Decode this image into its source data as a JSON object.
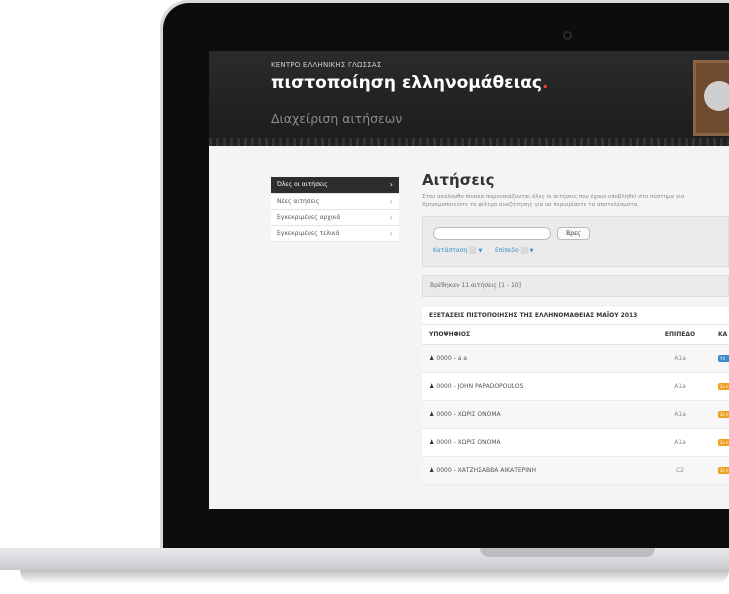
{
  "header": {
    "org": "ΚΕΝΤΡΟ ΕΛΛΗΝΙΚΗΣ ΓΛΩΣΣΑΣ",
    "brand": "πιστοποίηση ελληνομάθειας",
    "brand_dot": ".",
    "section": "Διαχείριση αιτήσεων"
  },
  "sidebar": {
    "items": [
      {
        "label": "Όλες οι αιτήσεις",
        "active": true
      },
      {
        "label": "Νέες αιτήσεις"
      },
      {
        "label": "Εγκεκριμένες αρχικά"
      },
      {
        "label": "Εγκεκριμένες τελικά"
      }
    ]
  },
  "main": {
    "title": "Αιτήσεις",
    "description_line1": "Στον ακόλουθο πίνακα παρουσιάζονται όλες οι αιτήσεις που έχουν υποβληθεί στο σύστημα για",
    "description_line2": "Χρησιμοποιείστε το φίλτρο αναζήτησης για να περιορίσετε τα αποτελέσματα."
  },
  "filters": {
    "search_button": "Βρες",
    "status_label": "Κατάσταση",
    "level_label": "Επίπεδο",
    "caret": "▼"
  },
  "results": {
    "text": "Βρέθηκαν 11 αιτήσεις [1 - 10]"
  },
  "table": {
    "exam_title": "ΕΞΕΤΑΣΕΙΣ ΠΙΣΤΟΠΟΙΗΣΗΣ ΤΗΣ ΕΛΛΗΝΟΜΑΘΕΙΑΣ ΜΑΪΟΥ 2013",
    "col_candidate": "ΥΠΟΨΗΦΙΟΣ",
    "col_level": "ΕΠΙΠΕΔΟ",
    "col_status": "ΚΑ",
    "rows": [
      {
        "candidate": "0000 - a a",
        "level": "A1a",
        "badge": "Υπ",
        "badge_color": "#3a8fc9"
      },
      {
        "candidate": "0000 - JOHN PAPADOPOULOS",
        "level": "A1a",
        "badge": "Σε ε",
        "badge_color": "#f0a020"
      },
      {
        "candidate": "0000 - ΧΩΡΙΣ ΟΝΟΜΑ",
        "level": "A1a",
        "badge": "Σε ε",
        "badge_color": "#f0a020"
      },
      {
        "candidate": "0000 - ΧΩΡΙΣ ΟΝΟΜΑ",
        "level": "A1a",
        "badge": "Σε ε",
        "badge_color": "#f0a020"
      },
      {
        "candidate": "0000 - ΧΑΤΖΗΣΑΒΒΑ ΑΙΚΑΤΕΡΙΝΗ",
        "level": "C2",
        "badge": "Σε ε",
        "badge_color": "#f0a020"
      }
    ]
  },
  "colors": {
    "header_bg": "#222222",
    "accent_red": "#e5462b",
    "link_blue": "#3a8fc9",
    "badge_orange": "#f0a020"
  }
}
